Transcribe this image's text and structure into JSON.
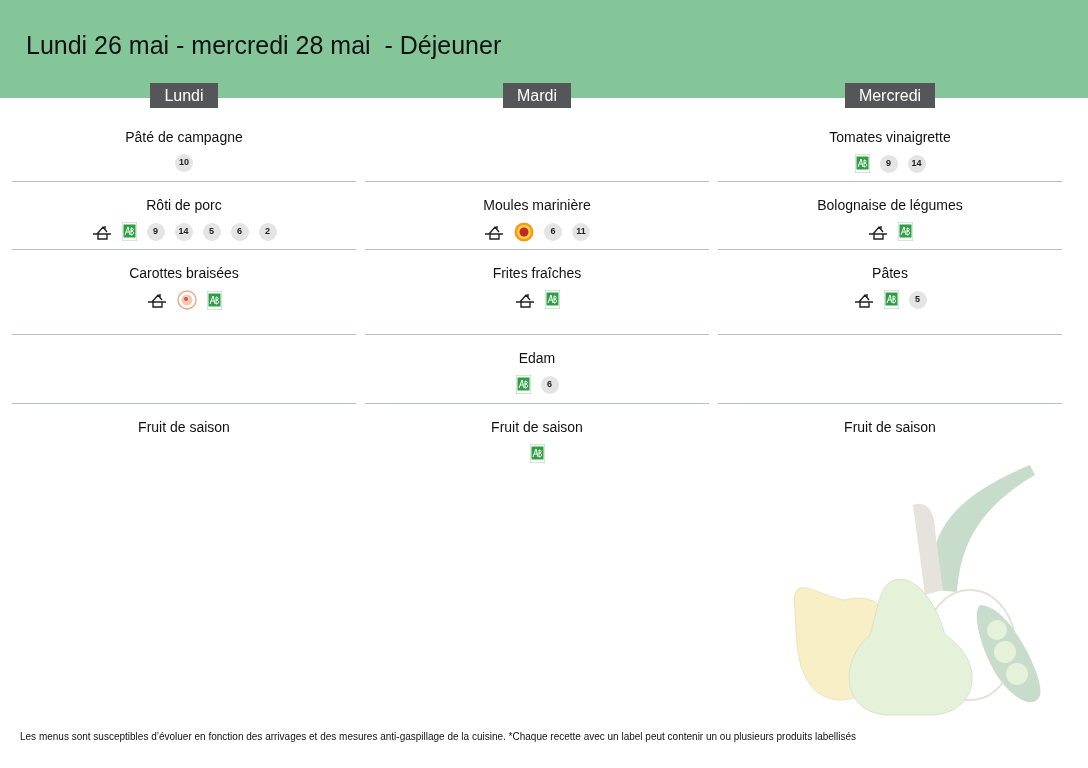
{
  "title": "Lundi 26 mai - mercredi 28 mai  - Déjeuner",
  "days": [
    {
      "name": "Lundi",
      "courses": [
        {
          "kind": "dish",
          "dish": "Pâté de campagne",
          "allergens": [
            "10"
          ]
        },
        {
          "kind": "dish",
          "dish": "Rôti de porc",
          "labels": [
            {
              "kind": "homemade"
            },
            {
              "kind": "organic"
            }
          ],
          "allergens": [
            "9",
            "14",
            "5",
            "6",
            "2"
          ]
        },
        {
          "kind": "dish",
          "dish": "Carottes braisées",
          "labels": [
            {
              "kind": "homemade"
            },
            {
              "kind": "seal"
            },
            {
              "kind": "organic"
            }
          ]
        },
        {
          "kind": "empty"
        },
        {
          "kind": "dish",
          "dish": "Fruit de saison"
        }
      ]
    },
    {
      "name": "Mardi",
      "courses": [
        {
          "kind": "empty"
        },
        {
          "kind": "dish",
          "dish": "Moules marinière",
          "labels": [
            {
              "kind": "homemade"
            },
            {
              "kind": "aop"
            }
          ],
          "allergens": [
            "6",
            "11"
          ]
        },
        {
          "kind": "dish",
          "dish": "Frites fraîches",
          "labels": [
            {
              "kind": "homemade"
            },
            {
              "kind": "organic"
            }
          ]
        },
        {
          "kind": "dish",
          "dish": "Edam",
          "labels": [
            {
              "kind": "organic"
            }
          ],
          "allergens": [
            "6"
          ]
        },
        {
          "kind": "dish",
          "dish": "Fruit de saison",
          "labels": [
            {
              "kind": "organic"
            }
          ]
        }
      ]
    },
    {
      "name": "Mercredi",
      "courses": [
        {
          "kind": "dish",
          "dish": "Tomates vinaigrette",
          "labels": [
            {
              "kind": "organic"
            }
          ],
          "allergens": [
            "9",
            "14"
          ]
        },
        {
          "kind": "dish",
          "dish": "Bolognaise de légumes",
          "labels": [
            {
              "kind": "homemade"
            },
            {
              "kind": "organic"
            }
          ]
        },
        {
          "kind": "dish",
          "dish": "Pâtes",
          "labels": [
            {
              "kind": "homemade"
            },
            {
              "kind": "organic"
            }
          ],
          "allergens": [
            "5"
          ]
        },
        {
          "kind": "empty"
        },
        {
          "kind": "dish",
          "dish": "Fruit de saison"
        }
      ]
    }
  ],
  "footer": "Les menus sont susceptibles d’évoluer en fonction des arrivages et des mesures anti-gaspillage de la cuisine. *Chaque recette avec un label peut contenir un ou plusieurs produits labellisés"
}
